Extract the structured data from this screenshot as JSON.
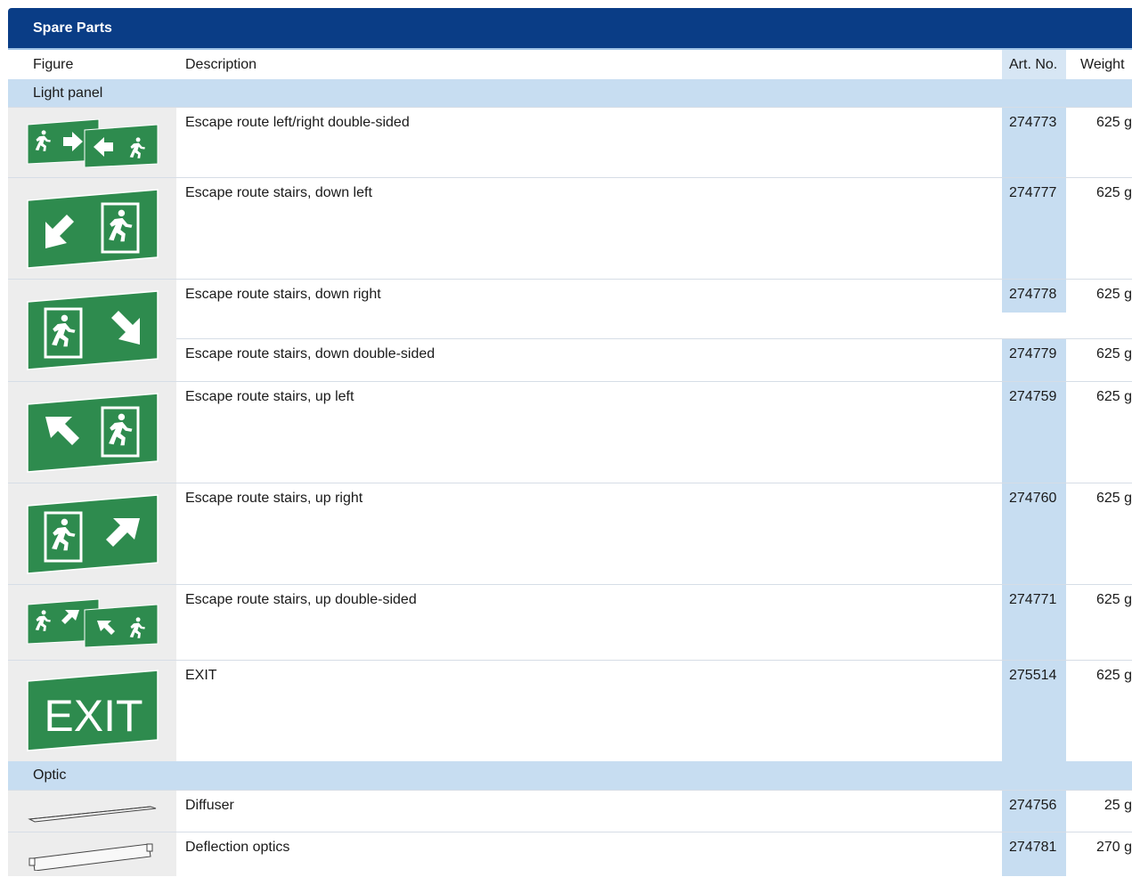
{
  "title": "Spare Parts",
  "columns": {
    "figure": "Figure",
    "description": "Description",
    "art_no": "Art. No.",
    "weight": "Weight"
  },
  "groups": {
    "light_panel": "Light panel",
    "optic": "Optic"
  },
  "rows": [
    {
      "description": "Escape route left/right double-sided",
      "art_no": "274773",
      "weight": "625 g",
      "figure_icon": "escape-left-right-double-sided-icon"
    },
    {
      "description": "Escape route stairs, down left",
      "art_no": "274777",
      "weight": "625 g",
      "figure_icon": "escape-stairs-down-left-icon"
    },
    {
      "description": "Escape route stairs, down right",
      "art_no": "274778",
      "weight": "625 g",
      "figure_icon": "escape-stairs-down-right-icon"
    },
    {
      "description": "Escape route stairs, down double-sided",
      "art_no": "274779",
      "weight": "625 g"
    },
    {
      "description": "Escape route stairs, up left",
      "art_no": "274759",
      "weight": "625 g",
      "figure_icon": "escape-stairs-up-left-icon"
    },
    {
      "description": "Escape route stairs, up right",
      "art_no": "274760",
      "weight": "625 g",
      "figure_icon": "escape-stairs-up-right-icon"
    },
    {
      "description": "Escape route stairs, up double-sided",
      "art_no": "274771",
      "weight": "625 g",
      "figure_icon": "escape-stairs-up-double-sided-icon"
    },
    {
      "description": "EXIT",
      "art_no": "275514",
      "weight": "625 g",
      "figure_icon": "exit-sign-icon",
      "sign_text": "EXIT"
    },
    {
      "description": "Diffuser",
      "art_no": "274756",
      "weight": "25 g",
      "figure_icon": "diffuser-icon"
    },
    {
      "description": "Deflection optics",
      "art_no": "274781",
      "weight": "270 g",
      "figure_icon": "deflection-optics-icon"
    }
  ],
  "colors": {
    "header_bg": "#0a3d86",
    "group_bg": "#c7ddf1",
    "sign_green": "#2e8b4e",
    "figure_bg": "#ededed"
  }
}
